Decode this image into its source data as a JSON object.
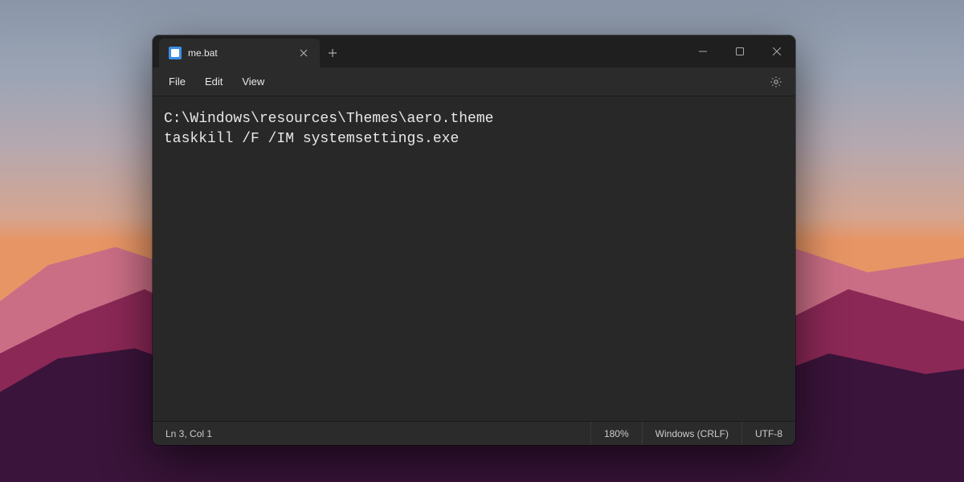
{
  "tab": {
    "title": "me.bat"
  },
  "menu": {
    "file": "File",
    "edit": "Edit",
    "view": "View"
  },
  "editor": {
    "content": "C:\\Windows\\resources\\Themes\\aero.theme\ntaskkill /F /IM systemsettings.exe"
  },
  "statusbar": {
    "cursor": "Ln 3, Col 1",
    "zoom": "180%",
    "line_endings": "Windows (CRLF)",
    "encoding": "UTF-8"
  }
}
